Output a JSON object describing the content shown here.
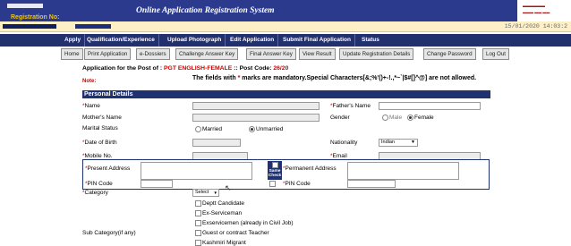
{
  "header": {
    "title": "Online Application Registration System",
    "registration_label": "Registration No:",
    "datetime": "15/01/2020 14:03:2"
  },
  "nav": [
    "Apply",
    "Qualification/Experience",
    "Upload Photograph",
    "Edit Application",
    "Submit Final Application",
    "Status"
  ],
  "subnav": [
    "Home",
    "Print Application",
    "e-Dossiers",
    "Challenge Answer Key",
    "Final Answer Key",
    "View Result",
    "Update Registration Details",
    "Change Password",
    "Log Out"
  ],
  "post": {
    "prefix": "Application for the Post of : ",
    "name": "PGT ENGLISH-FEMALE",
    "code_label": " :: Post Code: ",
    "code": "26/20"
  },
  "note": {
    "label": "Note:",
    "text_a": "The fields with ",
    "star": "*",
    "text_b": " marks are mandatory.Special Characters[&;%'()+-!.,*~`|$#[]^@] are not allowed."
  },
  "section_title": "Personal Details",
  "fields": {
    "name": "Name",
    "fathers_name": "Father's Name",
    "mothers_name": "Mother's Name",
    "gender": "Gender",
    "male": "Male",
    "female": "Female",
    "marital_status": "Marital Status",
    "married": "Married",
    "unmarried": "Unmarried",
    "dob": "Date of Birth",
    "nationality": "Nationality",
    "nationality_value": "Indian",
    "mobile": "Mobile No.",
    "email": "Email",
    "present_address": "Present Address",
    "permanent_address": "Permanent Address",
    "same_check": "Same Check",
    "pin_code": "PIN Code",
    "category": "Category",
    "category_select": "Select",
    "subcategory": "Sub Category(if any)"
  },
  "subcategories": [
    "Deptt Candidate",
    "Ex-Serviceman",
    "Exservicemen (already in Civil Job)",
    "Guest or contract Teacher",
    "Kashmiri Migrant"
  ],
  "icons": {
    "dropdown": "chevron-down-icon",
    "cursor": "mouse-pointer-icon"
  },
  "colors": {
    "banner": "#2b3a8c",
    "nav": "#23306e",
    "accent_text": "#f3c400",
    "mandatory": "#cc0000"
  }
}
